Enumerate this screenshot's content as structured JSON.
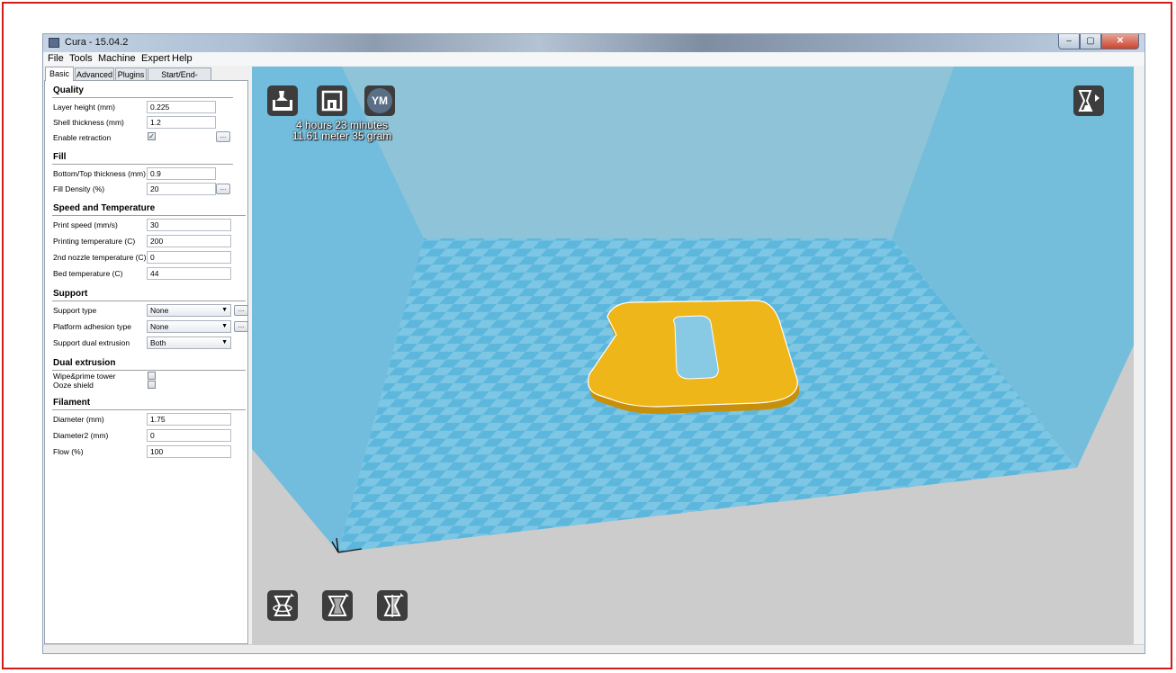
{
  "window": {
    "title": "Cura - 15.04.2",
    "min_label": "–",
    "max_label": "▢",
    "close_label": "✕"
  },
  "menu": {
    "file": "File",
    "tools": "Tools",
    "machine": "Machine",
    "expert": "Expert",
    "help": "Help"
  },
  "tabs": {
    "basic": "Basic",
    "advanced": "Advanced",
    "plugins": "Plugins",
    "start_end": "Start/End-GCode"
  },
  "quality": {
    "title": "Quality",
    "layer_height_label": "Layer height (mm)",
    "layer_height": "0.225",
    "shell_thickness_label": "Shell thickness (mm)",
    "shell_thickness": "1.2",
    "retraction_label": "Enable retraction",
    "retraction_checked": "✓"
  },
  "fill": {
    "title": "Fill",
    "bottom_top_label": "Bottom/Top thickness (mm)",
    "bottom_top": "0.9",
    "density_label": "Fill Density (%)",
    "density": "20"
  },
  "speed": {
    "title": "Speed and Temperature",
    "print_speed_label": "Print speed (mm/s)",
    "print_speed": "30",
    "print_temp_label": "Printing temperature (C)",
    "print_temp": "200",
    "nozzle2_label": "2nd nozzle temperature (C)",
    "nozzle2": "0",
    "bed_label": "Bed temperature (C)",
    "bed": "44"
  },
  "support": {
    "title": "Support",
    "type_label": "Support type",
    "type": "None",
    "adhesion_label": "Platform adhesion type",
    "adhesion": "None",
    "dual_label": "Support dual extrusion",
    "dual": "Both"
  },
  "dual": {
    "title": "Dual extrusion",
    "wipe_label": "Wipe&prime tower",
    "ooze_label": "Ooze shield"
  },
  "filament": {
    "title": "Filament",
    "diameter_label": "Diameter (mm)",
    "diameter": "1.75",
    "diameter2_label": "Diameter2 (mm)",
    "diameter2": "0",
    "flow_label": "Flow (%)",
    "flow": "100"
  },
  "more_button": "...",
  "print_info": {
    "time": "4 hours 23 minutes",
    "material": "11.61 meter 35 gram"
  },
  "youmagine_label": "YM",
  "colors": {
    "bed_blue": "#5fb9de",
    "wall_blue": "#7dc0d8",
    "model_yellow": "#efb619",
    "frame_red": "#d21b1b"
  }
}
